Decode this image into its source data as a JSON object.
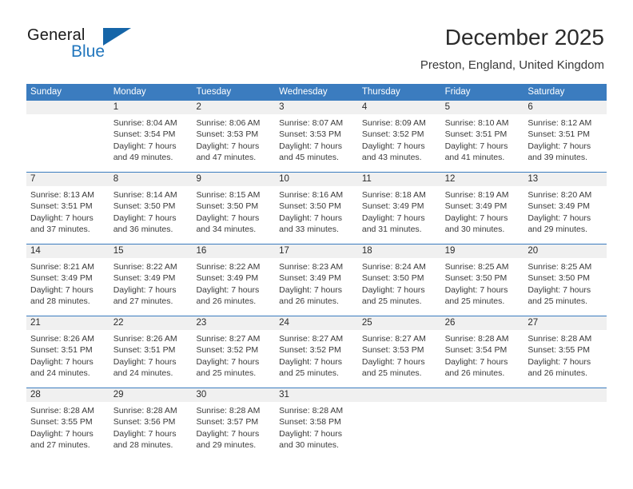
{
  "brand": {
    "name_part1": "General",
    "name_part2": "Blue",
    "accent_color": "#2176bd",
    "triangle_color": "#1565a8",
    "triangle_icon": "triangle-icon"
  },
  "header": {
    "title": "December 2025",
    "subtitle": "Preston, England, United Kingdom"
  },
  "calendar": {
    "header_bg": "#3b7cbf",
    "date_band_bg": "#f0f0f0",
    "weekdays": [
      "Sunday",
      "Monday",
      "Tuesday",
      "Wednesday",
      "Thursday",
      "Friday",
      "Saturday"
    ],
    "weeks": [
      [
        {
          "day": "",
          "lines": []
        },
        {
          "day": "1",
          "lines": [
            "Sunrise: 8:04 AM",
            "Sunset: 3:54 PM",
            "Daylight: 7 hours",
            "and 49 minutes."
          ]
        },
        {
          "day": "2",
          "lines": [
            "Sunrise: 8:06 AM",
            "Sunset: 3:53 PM",
            "Daylight: 7 hours",
            "and 47 minutes."
          ]
        },
        {
          "day": "3",
          "lines": [
            "Sunrise: 8:07 AM",
            "Sunset: 3:53 PM",
            "Daylight: 7 hours",
            "and 45 minutes."
          ]
        },
        {
          "day": "4",
          "lines": [
            "Sunrise: 8:09 AM",
            "Sunset: 3:52 PM",
            "Daylight: 7 hours",
            "and 43 minutes."
          ]
        },
        {
          "day": "5",
          "lines": [
            "Sunrise: 8:10 AM",
            "Sunset: 3:51 PM",
            "Daylight: 7 hours",
            "and 41 minutes."
          ]
        },
        {
          "day": "6",
          "lines": [
            "Sunrise: 8:12 AM",
            "Sunset: 3:51 PM",
            "Daylight: 7 hours",
            "and 39 minutes."
          ]
        }
      ],
      [
        {
          "day": "7",
          "lines": [
            "Sunrise: 8:13 AM",
            "Sunset: 3:51 PM",
            "Daylight: 7 hours",
            "and 37 minutes."
          ]
        },
        {
          "day": "8",
          "lines": [
            "Sunrise: 8:14 AM",
            "Sunset: 3:50 PM",
            "Daylight: 7 hours",
            "and 36 minutes."
          ]
        },
        {
          "day": "9",
          "lines": [
            "Sunrise: 8:15 AM",
            "Sunset: 3:50 PM",
            "Daylight: 7 hours",
            "and 34 minutes."
          ]
        },
        {
          "day": "10",
          "lines": [
            "Sunrise: 8:16 AM",
            "Sunset: 3:50 PM",
            "Daylight: 7 hours",
            "and 33 minutes."
          ]
        },
        {
          "day": "11",
          "lines": [
            "Sunrise: 8:18 AM",
            "Sunset: 3:49 PM",
            "Daylight: 7 hours",
            "and 31 minutes."
          ]
        },
        {
          "day": "12",
          "lines": [
            "Sunrise: 8:19 AM",
            "Sunset: 3:49 PM",
            "Daylight: 7 hours",
            "and 30 minutes."
          ]
        },
        {
          "day": "13",
          "lines": [
            "Sunrise: 8:20 AM",
            "Sunset: 3:49 PM",
            "Daylight: 7 hours",
            "and 29 minutes."
          ]
        }
      ],
      [
        {
          "day": "14",
          "lines": [
            "Sunrise: 8:21 AM",
            "Sunset: 3:49 PM",
            "Daylight: 7 hours",
            "and 28 minutes."
          ]
        },
        {
          "day": "15",
          "lines": [
            "Sunrise: 8:22 AM",
            "Sunset: 3:49 PM",
            "Daylight: 7 hours",
            "and 27 minutes."
          ]
        },
        {
          "day": "16",
          "lines": [
            "Sunrise: 8:22 AM",
            "Sunset: 3:49 PM",
            "Daylight: 7 hours",
            "and 26 minutes."
          ]
        },
        {
          "day": "17",
          "lines": [
            "Sunrise: 8:23 AM",
            "Sunset: 3:49 PM",
            "Daylight: 7 hours",
            "and 26 minutes."
          ]
        },
        {
          "day": "18",
          "lines": [
            "Sunrise: 8:24 AM",
            "Sunset: 3:50 PM",
            "Daylight: 7 hours",
            "and 25 minutes."
          ]
        },
        {
          "day": "19",
          "lines": [
            "Sunrise: 8:25 AM",
            "Sunset: 3:50 PM",
            "Daylight: 7 hours",
            "and 25 minutes."
          ]
        },
        {
          "day": "20",
          "lines": [
            "Sunrise: 8:25 AM",
            "Sunset: 3:50 PM",
            "Daylight: 7 hours",
            "and 25 minutes."
          ]
        }
      ],
      [
        {
          "day": "21",
          "lines": [
            "Sunrise: 8:26 AM",
            "Sunset: 3:51 PM",
            "Daylight: 7 hours",
            "and 24 minutes."
          ]
        },
        {
          "day": "22",
          "lines": [
            "Sunrise: 8:26 AM",
            "Sunset: 3:51 PM",
            "Daylight: 7 hours",
            "and 24 minutes."
          ]
        },
        {
          "day": "23",
          "lines": [
            "Sunrise: 8:27 AM",
            "Sunset: 3:52 PM",
            "Daylight: 7 hours",
            "and 25 minutes."
          ]
        },
        {
          "day": "24",
          "lines": [
            "Sunrise: 8:27 AM",
            "Sunset: 3:52 PM",
            "Daylight: 7 hours",
            "and 25 minutes."
          ]
        },
        {
          "day": "25",
          "lines": [
            "Sunrise: 8:27 AM",
            "Sunset: 3:53 PM",
            "Daylight: 7 hours",
            "and 25 minutes."
          ]
        },
        {
          "day": "26",
          "lines": [
            "Sunrise: 8:28 AM",
            "Sunset: 3:54 PM",
            "Daylight: 7 hours",
            "and 26 minutes."
          ]
        },
        {
          "day": "27",
          "lines": [
            "Sunrise: 8:28 AM",
            "Sunset: 3:55 PM",
            "Daylight: 7 hours",
            "and 26 minutes."
          ]
        }
      ],
      [
        {
          "day": "28",
          "lines": [
            "Sunrise: 8:28 AM",
            "Sunset: 3:55 PM",
            "Daylight: 7 hours",
            "and 27 minutes."
          ]
        },
        {
          "day": "29",
          "lines": [
            "Sunrise: 8:28 AM",
            "Sunset: 3:56 PM",
            "Daylight: 7 hours",
            "and 28 minutes."
          ]
        },
        {
          "day": "30",
          "lines": [
            "Sunrise: 8:28 AM",
            "Sunset: 3:57 PM",
            "Daylight: 7 hours",
            "and 29 minutes."
          ]
        },
        {
          "day": "31",
          "lines": [
            "Sunrise: 8:28 AM",
            "Sunset: 3:58 PM",
            "Daylight: 7 hours",
            "and 30 minutes."
          ]
        },
        {
          "day": "",
          "lines": []
        },
        {
          "day": "",
          "lines": []
        },
        {
          "day": "",
          "lines": []
        }
      ]
    ]
  }
}
